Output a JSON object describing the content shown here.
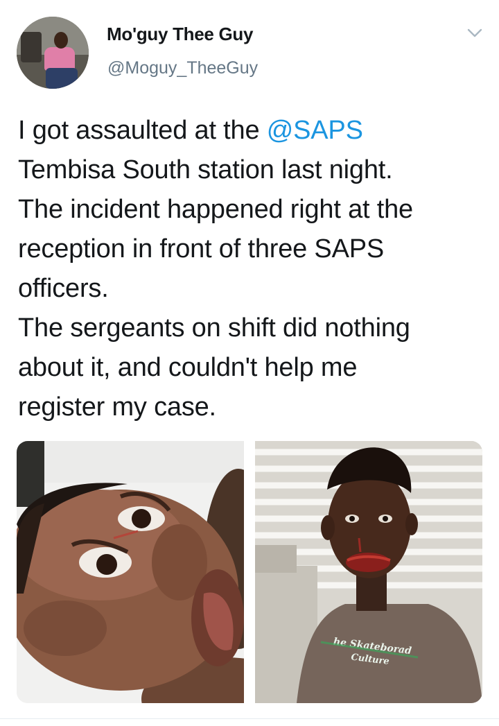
{
  "author": {
    "display_name": "Mo'guy Thee Guy",
    "handle": "@Moguy_TheeGuy",
    "avatar_icon": "profile-photo"
  },
  "tweet": {
    "text_before_mention": "I got assaulted at the ",
    "mention": "@SAPS",
    "text_after_mention": "\nTembisa South station last night.\nThe incident happened right at the\nreception in front of three SAPS\nofficers.\nThe sergeants on shift did nothing\nabout it, and couldn't help me\nregister my case."
  },
  "media": {
    "right_photo_shirt_text_line1": "he Skateborad",
    "right_photo_shirt_text_line2": "Culture"
  },
  "colors": {
    "link": "#1b95e0",
    "secondary_text": "#657786",
    "primary_text": "#14171a",
    "chevron": "#aab8c2"
  }
}
